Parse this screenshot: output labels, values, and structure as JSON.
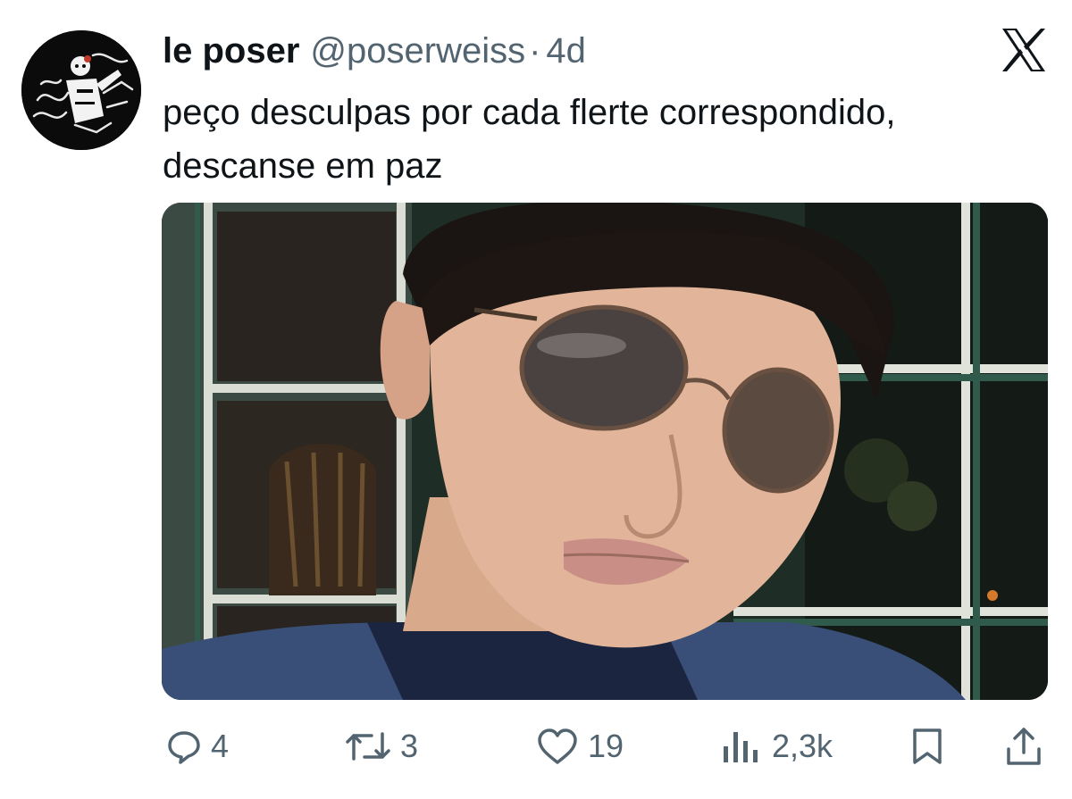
{
  "author": {
    "display_name": "le poser",
    "handle": "@poserweiss",
    "separator": "·",
    "time": "4d",
    "avatar_icon": "illustrated-figure-avatar"
  },
  "platform_logo": "x-logo-icon",
  "tweet": {
    "text_lines": [
      "peço desculpas por cada flerte correspondido,",
      "descanse em paz"
    ]
  },
  "media": {
    "type": "photo",
    "description_icon": "photo-image"
  },
  "actions": {
    "reply": {
      "icon": "reply-bubble-icon",
      "count": "4"
    },
    "retweet": {
      "icon": "retweet-arrows-icon",
      "count": "3"
    },
    "like": {
      "icon": "heart-icon",
      "count": "19"
    },
    "views": {
      "icon": "views-bar-chart-icon",
      "count": "2,3k"
    },
    "bookmark": {
      "icon": "bookmark-icon"
    },
    "share": {
      "icon": "share-upload-icon"
    }
  },
  "colors": {
    "text_primary": "#0f1419",
    "text_secondary": "#536471",
    "background": "#ffffff"
  }
}
